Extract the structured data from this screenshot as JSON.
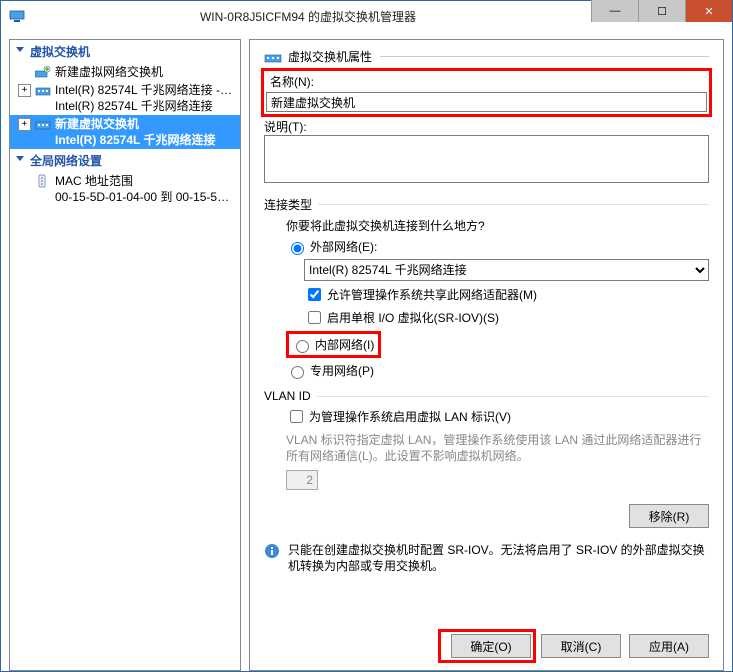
{
  "window": {
    "title": "WIN-0R8J5ICFM94 的虚拟交换机管理器"
  },
  "win_controls": {
    "minimize": "—",
    "maximize": "☐",
    "close": "✕"
  },
  "tree": {
    "section_switches": "虚拟交换机",
    "new_switch": "新建虚拟网络交换机",
    "item1_main": "Intel(R) 82574L 千兆网络连接 - Vi...",
    "item1_sub": "Intel(R) 82574L 千兆网络连接",
    "item2_main": "新建虚拟交换机",
    "item2_sub": "Intel(R) 82574L 千兆网络连接",
    "section_global": "全局网络设置",
    "mac_main": "MAC 地址范围",
    "mac_sub": "00-15-5D-01-04-00 到 00-15-5D-0..."
  },
  "detail": {
    "section_title": "虚拟交换机属性",
    "name_label": "名称(N):",
    "name_value": "新建虚拟交换机",
    "desc_label": "说明(T):",
    "desc_value": "",
    "conn_type_label": "连接类型",
    "conn_prompt": "你要将此虚拟交换机连接到什么地方?",
    "radio_external": "外部网络(E):",
    "adapter_selected": "Intel(R) 82574L 千兆网络连接",
    "check_allow_mgmt": "允许管理操作系统共享此网络适配器(M)",
    "check_sriov": "启用单根 I/O 虚拟化(SR-IOV)(S)",
    "radio_internal": "内部网络(I)",
    "radio_private": "专用网络(P)",
    "vlan_label": "VLAN ID",
    "check_vlan": "为管理操作系统启用虚拟 LAN 标识(V)",
    "vlan_help": "VLAN 标识符指定虚拟 LAN，管理操作系统使用该 LAN 通过此网络适配器进行所有网络通信(L)。此设置不影响虚拟机网络。",
    "vlan_value": "2",
    "remove_btn": "移除(R)",
    "info_text": "只能在创建虚拟交换机时配置 SR-IOV。无法将启用了 SR-IOV 的外部虚拟交换机转换为内部或专用交换机。"
  },
  "footer": {
    "ok": "确定(O)",
    "cancel": "取消(C)",
    "apply": "应用(A)"
  }
}
